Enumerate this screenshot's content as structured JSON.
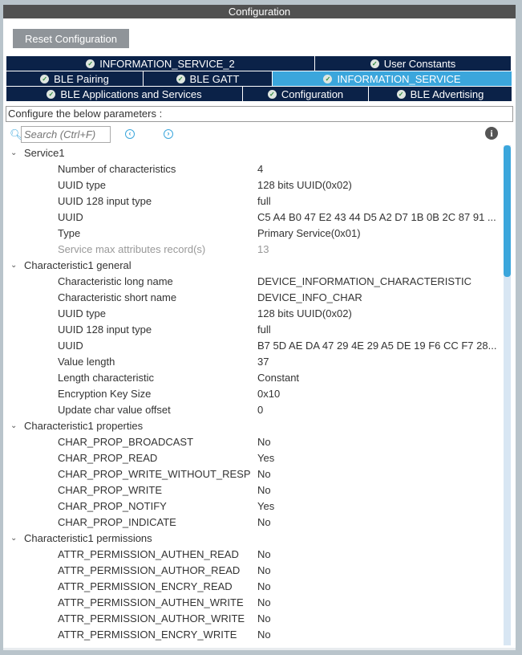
{
  "header": {
    "title": "Configuration"
  },
  "reset_label": "Reset Configuration",
  "tabs": [
    [
      {
        "label": "INFORMATION_SERVICE_2",
        "active": false
      },
      {
        "label": "User Constants",
        "active": false
      }
    ],
    [
      {
        "label": "BLE Pairing",
        "active": false
      },
      {
        "label": "BLE GATT",
        "active": false
      },
      {
        "label": "INFORMATION_SERVICE",
        "active": true
      }
    ],
    [
      {
        "label": "BLE Applications and Services",
        "active": false
      },
      {
        "label": "Configuration",
        "active": false
      },
      {
        "label": "BLE Advertising",
        "active": false
      }
    ]
  ],
  "configure_label": "Configure the below parameters :",
  "search": {
    "placeholder": "Search (Ctrl+F)"
  },
  "groups": [
    {
      "name": "Service1",
      "params": [
        {
          "label": "Number of characteristics",
          "value": "4"
        },
        {
          "label": "UUID type",
          "value": "128 bits UUID(0x02)"
        },
        {
          "label": "UUID 128 input type",
          "value": "full"
        },
        {
          "label": "UUID",
          "value": "C5 A4 B0 47 E2 43 44 D5 A2 D7 1B 0B 2C 87 91 ..."
        },
        {
          "label": "Type",
          "value": "Primary Service(0x01)"
        },
        {
          "label": "Service max attributes record(s)",
          "value": "13",
          "disabled": true
        }
      ]
    },
    {
      "name": "Characteristic1 general",
      "params": [
        {
          "label": "Characteristic long name",
          "value": "DEVICE_INFORMATION_CHARACTERISTIC"
        },
        {
          "label": "Characteristic short name",
          "value": "DEVICE_INFO_CHAR"
        },
        {
          "label": "UUID type",
          "value": "128 bits UUID(0x02)"
        },
        {
          "label": "UUID 128 input type",
          "value": "full"
        },
        {
          "label": "UUID",
          "value": "B7 5D AE DA 47 29 4E 29 A5 DE 19 F6 CC F7 28..."
        },
        {
          "label": "Value length",
          "value": "37"
        },
        {
          "label": "Length characteristic",
          "value": "Constant"
        },
        {
          "label": "Encryption Key Size",
          "value": "0x10"
        },
        {
          "label": "Update char value offset",
          "value": "0"
        }
      ]
    },
    {
      "name": "Characteristic1 properties",
      "params": [
        {
          "label": "CHAR_PROP_BROADCAST",
          "value": "No"
        },
        {
          "label": "CHAR_PROP_READ",
          "value": "Yes"
        },
        {
          "label": "CHAR_PROP_WRITE_WITHOUT_RESP",
          "value": "No"
        },
        {
          "label": "CHAR_PROP_WRITE",
          "value": "No"
        },
        {
          "label": "CHAR_PROP_NOTIFY",
          "value": "Yes"
        },
        {
          "label": "CHAR_PROP_INDICATE",
          "value": "No"
        }
      ]
    },
    {
      "name": "Characteristic1 permissions",
      "params": [
        {
          "label": "ATTR_PERMISSION_AUTHEN_READ",
          "value": "No"
        },
        {
          "label": "ATTR_PERMISSION_AUTHOR_READ",
          "value": "No"
        },
        {
          "label": "ATTR_PERMISSION_ENCRY_READ",
          "value": "No"
        },
        {
          "label": "ATTR_PERMISSION_AUTHEN_WRITE",
          "value": "No"
        },
        {
          "label": "ATTR_PERMISSION_AUTHOR_WRITE",
          "value": "No"
        },
        {
          "label": "ATTR_PERMISSION_ENCRY_WRITE",
          "value": "No"
        }
      ]
    }
  ]
}
